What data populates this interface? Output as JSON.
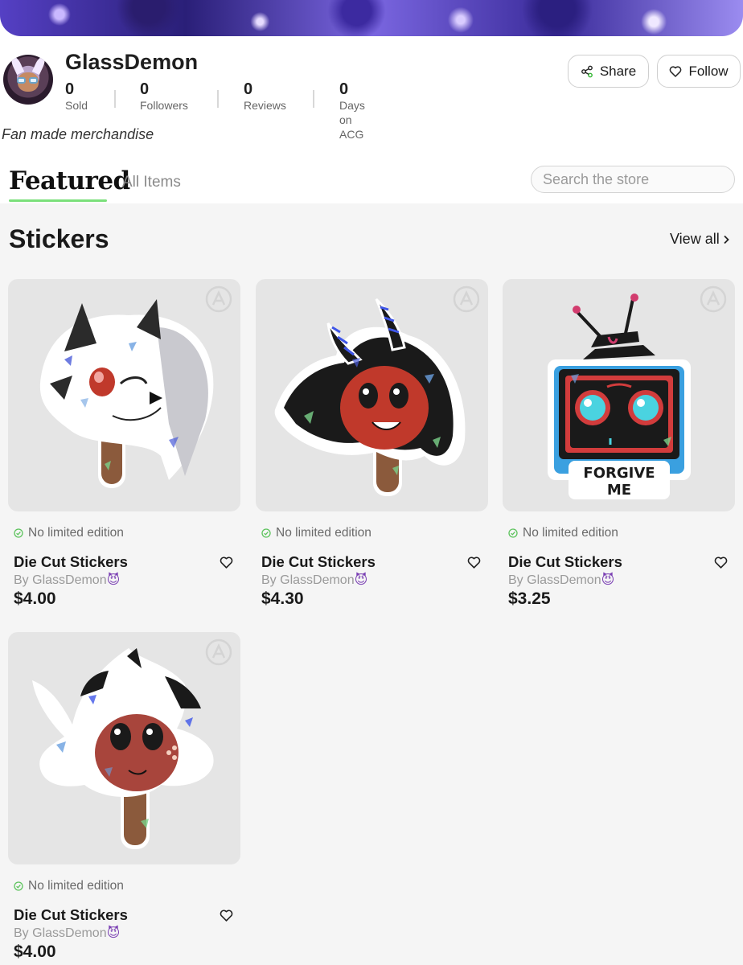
{
  "store": {
    "name": "GlassDemon",
    "bio": "Fan made merchandise",
    "stats": [
      {
        "value": "0",
        "label": "Sold"
      },
      {
        "value": "0",
        "label": "Followers"
      },
      {
        "value": "0",
        "label": "Reviews"
      },
      {
        "value": "0",
        "label": "Days on ACG"
      }
    ]
  },
  "actions": {
    "share_label": "Share",
    "follow_label": "Follow"
  },
  "tabs": {
    "featured": "Featured",
    "all_items": "All Items"
  },
  "search": {
    "placeholder": "Search the store"
  },
  "section": {
    "title": "Stickers",
    "view_all": "View all"
  },
  "products": [
    {
      "edition": "No limited edition",
      "title": "Die Cut Stickers",
      "author": "By GlassDemon",
      "author_emoji": "😈",
      "price": "$4.00"
    },
    {
      "edition": "No limited edition",
      "title": "Die Cut Stickers",
      "author": "By GlassDemon",
      "author_emoji": "😈",
      "price": "$4.30"
    },
    {
      "edition": "No limited edition",
      "title": "Die Cut Stickers",
      "author": "By GlassDemon",
      "author_emoji": "😈",
      "price": "$3.25"
    },
    {
      "edition": "No limited edition",
      "title": "Die Cut Stickers",
      "author": "By GlassDemon",
      "author_emoji": "😈",
      "price": "$4.00"
    }
  ],
  "sticker_text": {
    "tv_caption_line1": "FORGIVE",
    "tv_caption_line2": "ME"
  },
  "colors": {
    "accent_underline": "#7be07b",
    "check_green": "#5cc35c",
    "card_bg": "#e5e5e5",
    "page_bg": "#f5f5f5"
  },
  "icons": [
    "share-icon",
    "heart-icon",
    "search-icon",
    "chevron-right-icon",
    "check-circle-icon",
    "watermark-icon"
  ]
}
